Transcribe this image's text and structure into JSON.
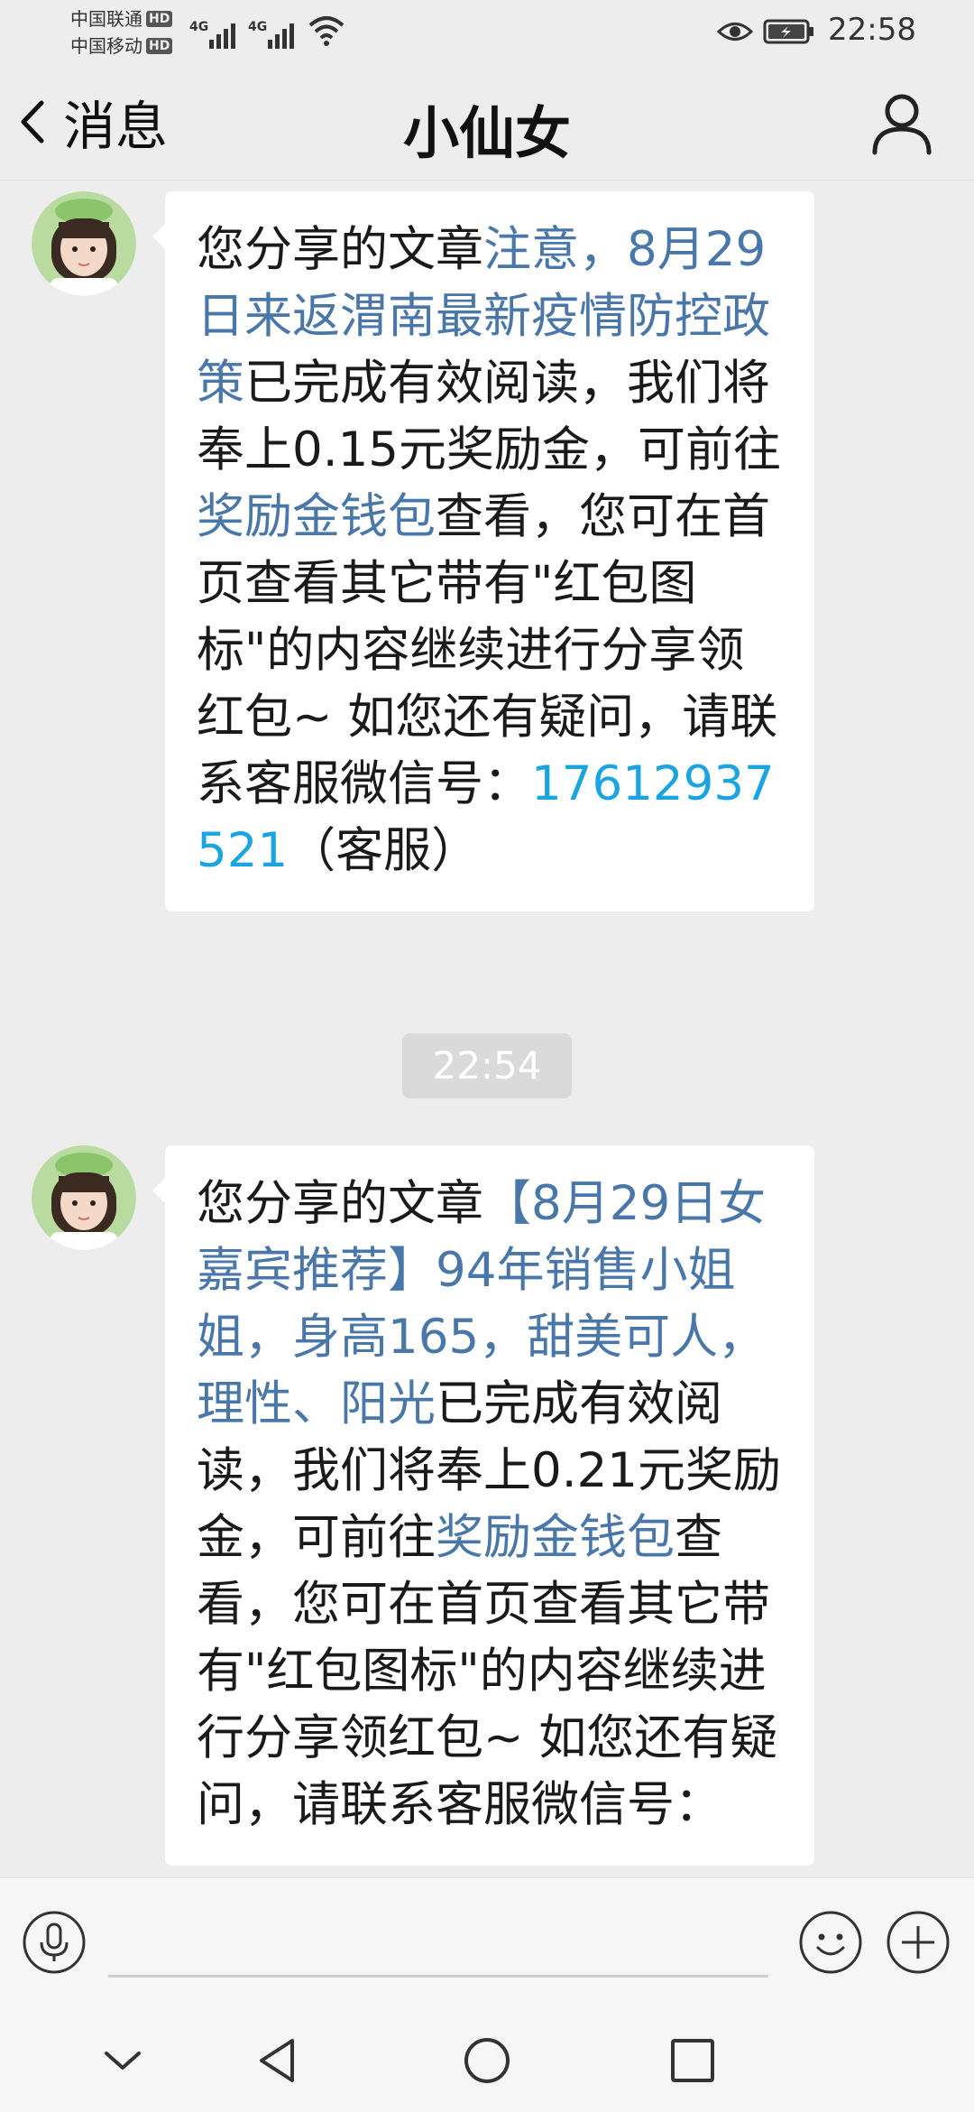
{
  "status_bar": {
    "carriers": [
      {
        "name": "中国联通",
        "badge": "HD"
      },
      {
        "name": "中国移动",
        "badge": "HD"
      }
    ],
    "signal_labels": [
      "4G",
      "4G"
    ],
    "time": "22:58"
  },
  "header": {
    "back_label": "消息",
    "title": "小仙女"
  },
  "messages": [
    {
      "segments": [
        {
          "text": "您分享的文章",
          "link": false
        },
        {
          "text": "注意，8月29日来返渭南最新疫情防控政策",
          "link": true
        },
        {
          "text": "已完成有效阅读，我们将奉上0.15元奖励金，可前往",
          "link": false
        },
        {
          "text": "奖励金钱包",
          "link": true
        },
        {
          "text": "查看，您可在首页查看其它带有\"红包图标\"的内容继续进行分享领红包~ 如您还有疑问，请联系客服微信号：",
          "link": false
        },
        {
          "text": "17612937521",
          "phone": true
        },
        {
          "text": "（客服）",
          "link": false
        }
      ]
    },
    {
      "segments": [
        {
          "text": "您分享的文章",
          "link": false
        },
        {
          "text": "【8月29日女嘉宾推荐】94年销售小姐姐，身高165，甜美可人，理性、阳光",
          "link": true
        },
        {
          "text": "已完成有效阅读，我们将奉上0.21元奖励金，可前往",
          "link": false
        },
        {
          "text": "奖励金钱包",
          "link": true
        },
        {
          "text": "查看，您可在首页查看其它带有\"红包图标\"的内容继续进行分享领红包~ 如您还有疑问，请联系客服微信号：",
          "link": false
        }
      ]
    }
  ],
  "time_divider": "22:54",
  "input": {
    "value": "",
    "placeholder": ""
  },
  "icons": {
    "voice": "microphone-icon",
    "emoji": "smiley-icon",
    "more": "plus-icon",
    "back": "chevron-left-icon",
    "profile": "person-icon",
    "nav_hide": "chevron-down-icon",
    "nav_back": "triangle-back-icon",
    "nav_home": "circle-home-icon",
    "nav_recents": "square-recents-icon"
  },
  "colors": {
    "background": "#ededed",
    "bubble": "#ffffff",
    "link": "#4a77a9",
    "phone_link": "#1aa5e2"
  }
}
